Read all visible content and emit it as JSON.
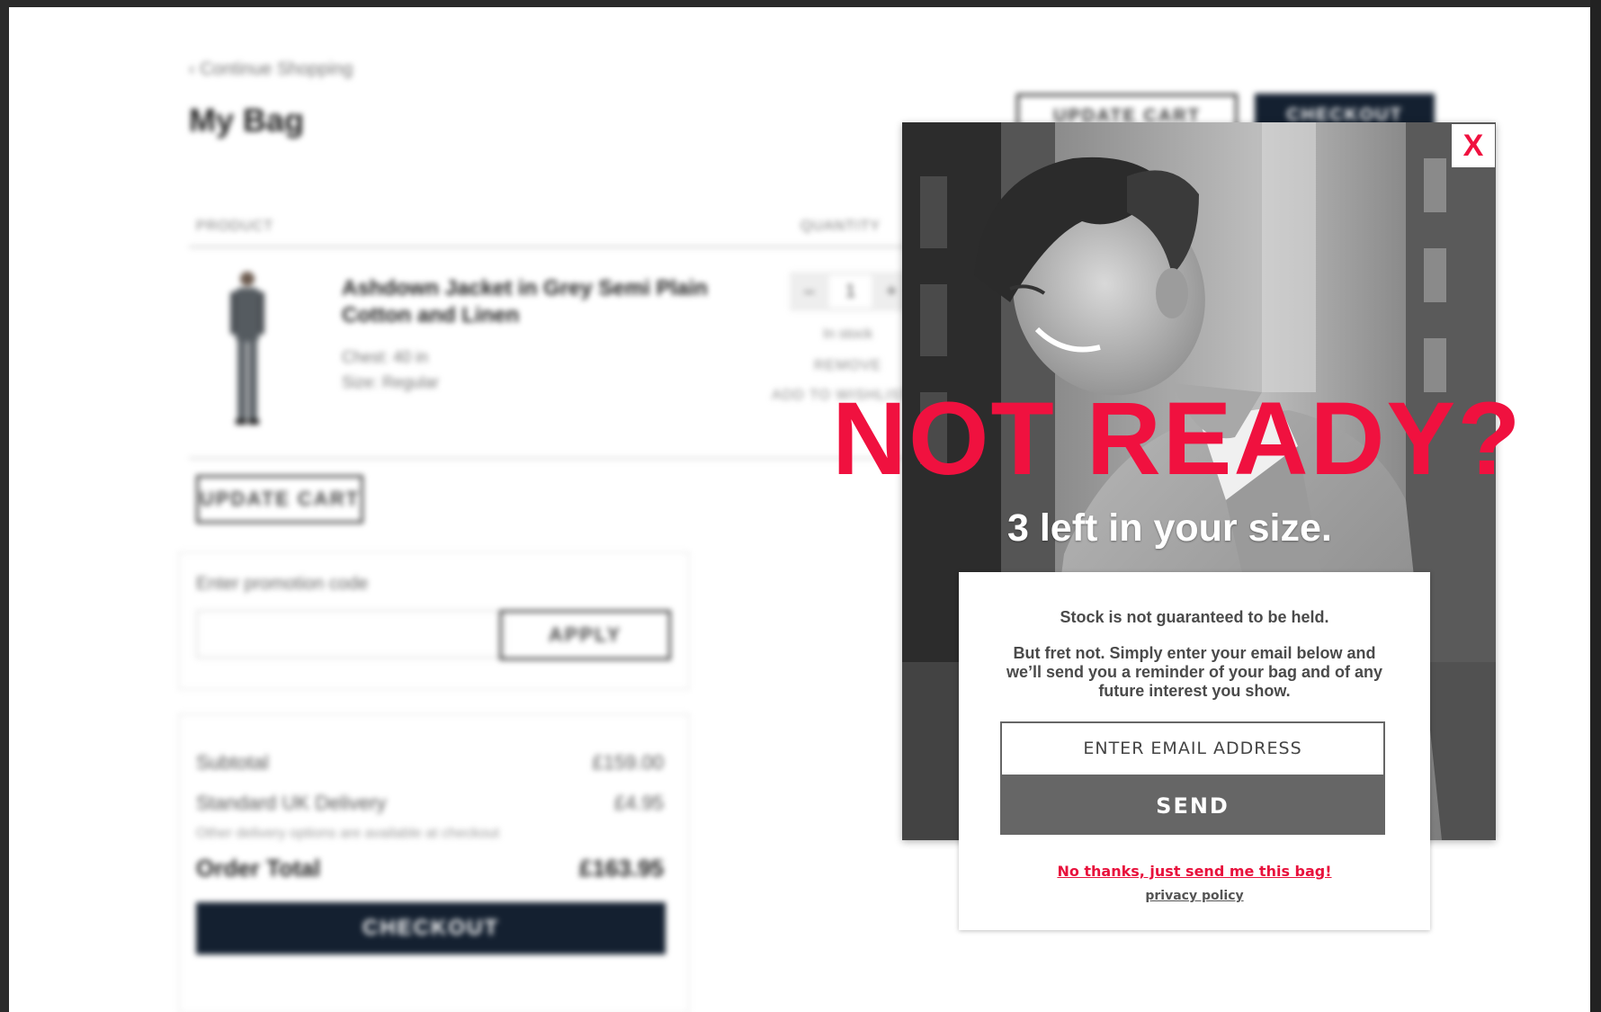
{
  "cart": {
    "back_link": "‹ Continue Shopping",
    "title": "My Bag",
    "top_update_label": "UPDATE CART",
    "top_checkout_label": "CHECKOUT",
    "col_product": "PRODUCT",
    "col_quantity": "QUANTITY",
    "product": {
      "name": "Ashdown Jacket in Grey Semi Plain Cotton and Linen",
      "chest": "Chest: 40 in",
      "size": "Size: Regular",
      "quantity": "1",
      "minus": "–",
      "plus": "+",
      "stock": "In stock",
      "remove": "REMOVE",
      "wishlist": "ADD TO WISHLIST"
    },
    "update_label": "UPDATE CART",
    "promo_label": "Enter promotion code",
    "apply_label": "APPLY",
    "summary": {
      "subtotal_label": "Subtotal",
      "subtotal_value": "£159.00",
      "delivery_label": "Standard UK Delivery",
      "delivery_value": "£4.95",
      "delivery_note": "Other delivery options are available at checkout",
      "total_label": "Order Total",
      "total_value": "£163.95"
    },
    "checkout_label": "CHECKOUT"
  },
  "modal": {
    "close_label": "X",
    "headline": "NOT READY?",
    "subhead": "3 left in your size.",
    "message_1": "Stock is not guaranteed to be held.",
    "message_2": "But fret not. Simply enter your email below and we’ll send you a reminder of your bag and of any future interest you show.",
    "email_placeholder": "ENTER EMAIL ADDRESS",
    "send_label": "SEND",
    "no_thanks": "No thanks, just send me this bag!",
    "privacy": "privacy policy",
    "colors": {
      "accent": "#f0113f",
      "send_button": "#666666"
    }
  }
}
